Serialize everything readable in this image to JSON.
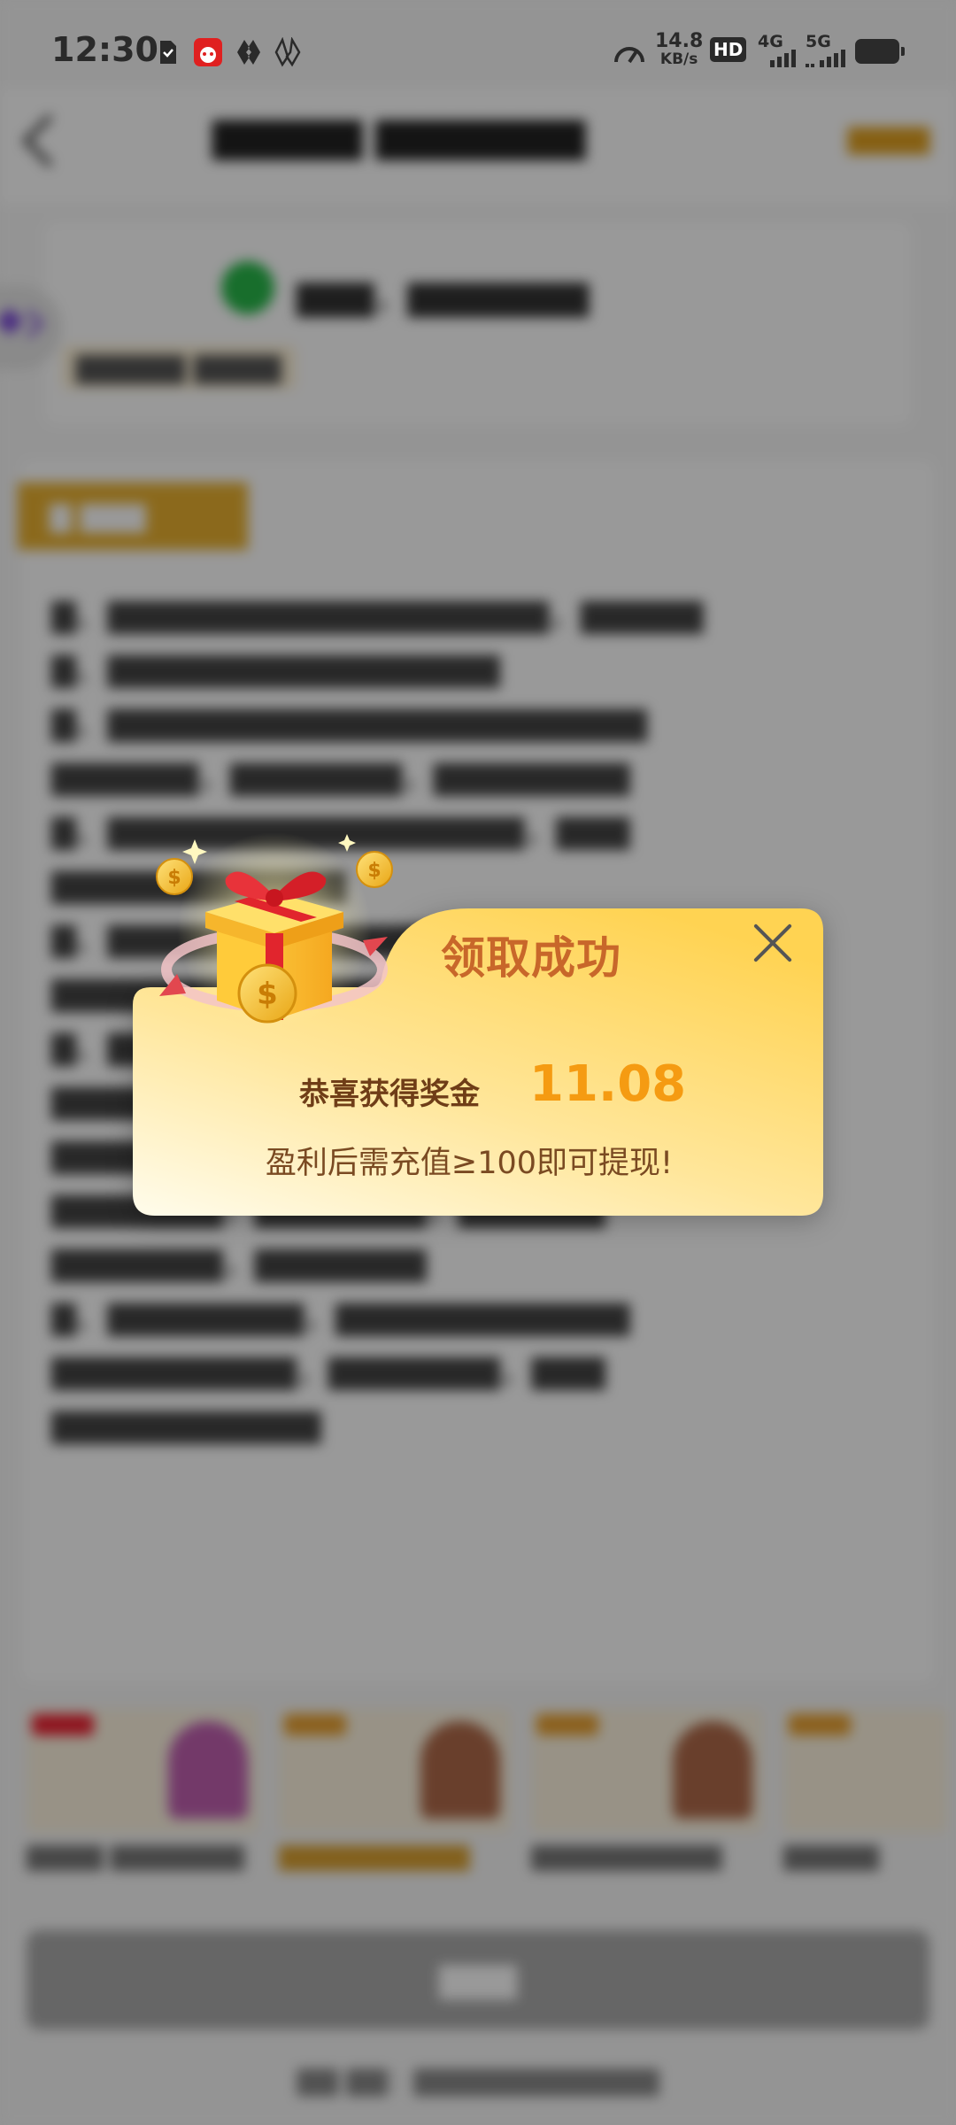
{
  "status_bar": {
    "time": "12:30",
    "speed_value": "14.8",
    "speed_unit": "KB/s",
    "hd_label": "HD",
    "net_4g": "4G",
    "net_5g": "5G"
  },
  "dialog": {
    "title": "领取成功",
    "reward_label": "恭喜获得奖金",
    "reward_amount": "11.08",
    "note": "盈利后需充值≥100即可提现!"
  },
  "colors": {
    "dialog_top": "#ffd35a",
    "dialog_bottom": "#fff7dc",
    "title": "#c8672a",
    "amount": "#f59b12"
  },
  "icons": [
    "back-icon",
    "close-icon",
    "gift-icon",
    "coin-icon",
    "speed-icon",
    "battery-icon",
    "signal-icon"
  ]
}
